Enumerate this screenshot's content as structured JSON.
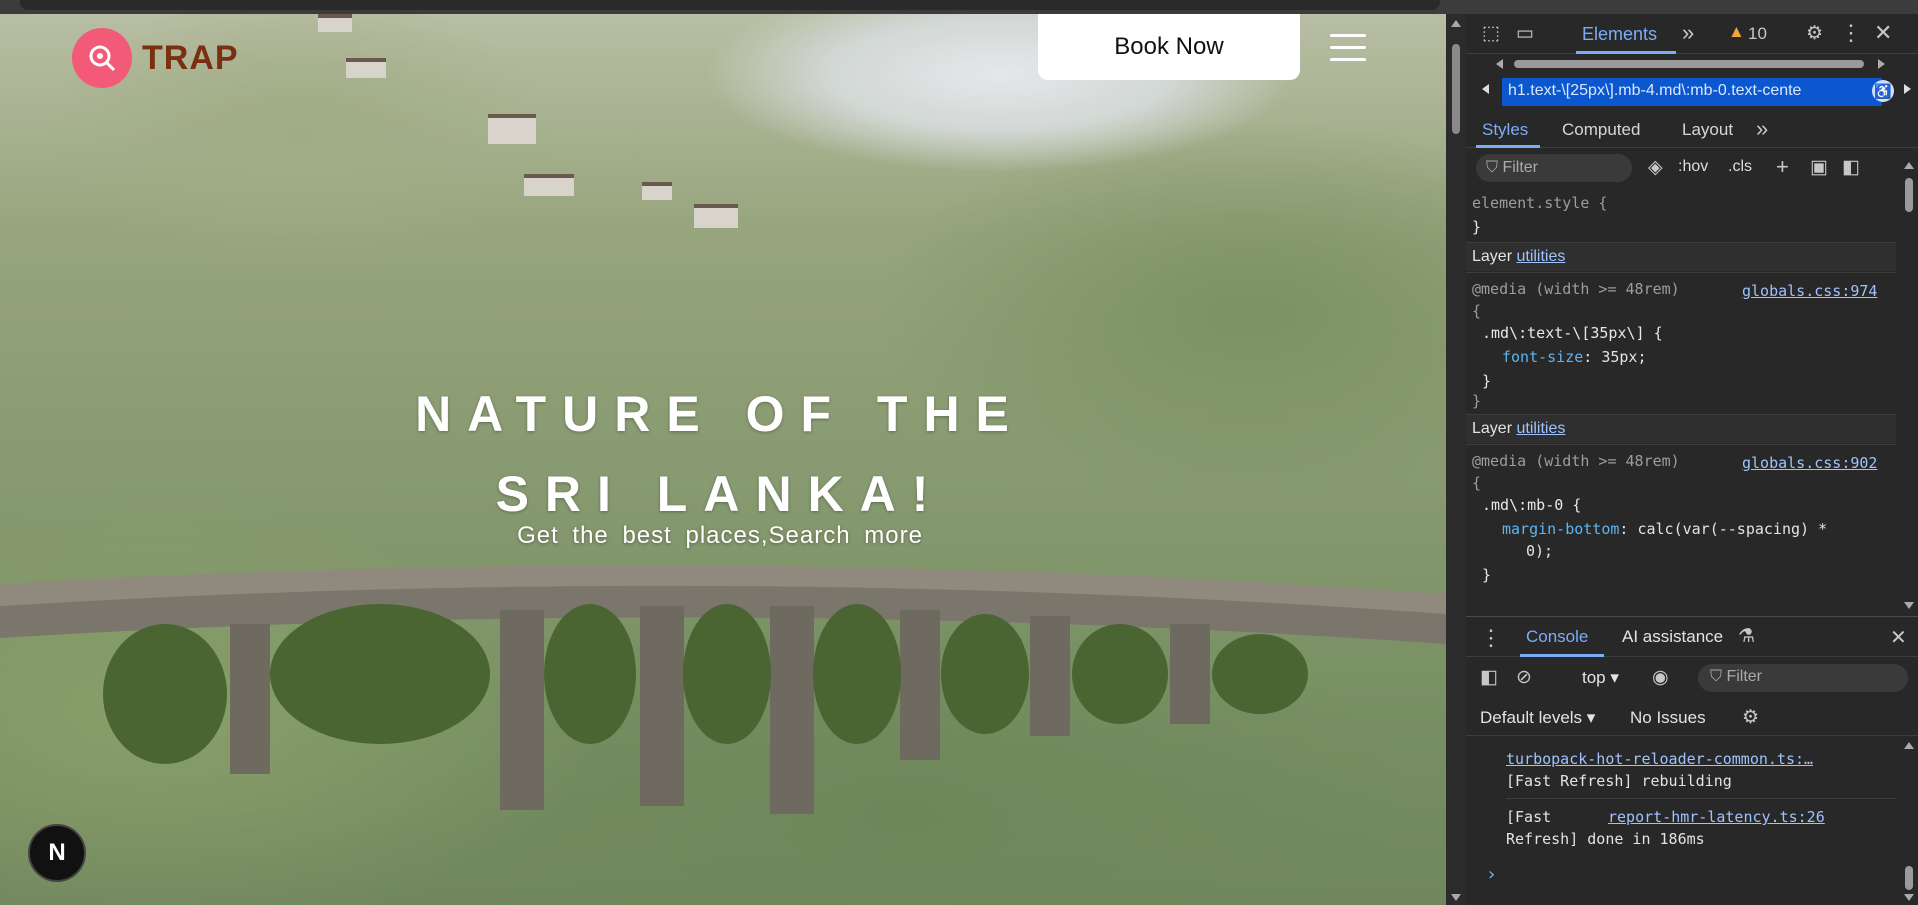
{
  "site": {
    "brand": "TRAP",
    "book_button": "Book Now",
    "hero_title_line1": "NATURE OF THE",
    "hero_title_line2": "SRI LANKA!",
    "hero_subtitle": "Get the best places,Search more",
    "next_badge": "N"
  },
  "devtools": {
    "toolbar": {
      "elements_tab": "Elements",
      "warning_count": "10"
    },
    "breadcrumb": "h1.text-\\[25px\\].mb-4.md\\:mb-0.text-cente",
    "subtabs": {
      "styles": "Styles",
      "computed": "Computed",
      "layout": "Layout"
    },
    "filter_placeholder": "Filter",
    "hov": ":hov",
    "cls": ".cls",
    "rules": {
      "element_style_open": "element.style {",
      "element_style_close": "}",
      "layer1_prefix": "Layer ",
      "layer1_link": "utilities",
      "media1": "@media (width >= 48rem)",
      "source1": "globals.css:974",
      "brace_open1": "{",
      "selector1": ".md\\:text-\\[35px\\] {",
      "prop1_name": "font-size",
      "prop1_value": ": 35px;",
      "close1a": "}",
      "close1b": "}",
      "layer2_prefix": "Layer ",
      "layer2_link": "utilities",
      "media2": "@media (width >= 48rem)",
      "source2": "globals.css:902",
      "brace_open2": "{",
      "selector2": ".md\\:mb-0 {",
      "prop2_name": "margin-bottom",
      "prop2_value": ": calc(var(--spacing) *",
      "prop2_value_cont": "0);",
      "close2": "}"
    },
    "drawer": {
      "console_tab": "Console",
      "ai_tab": "AI assistance",
      "context": "top",
      "filter_placeholder": "Filter",
      "levels": "Default levels",
      "issues": "No Issues",
      "msg1_link": "turbopack-hot-reloader-common.ts:…",
      "msg1_text": "[Fast Refresh] rebuilding",
      "msg2_text_a": "[Fast",
      "msg2_link": "report-hmr-latency.ts:26",
      "msg2_text_b": "Refresh] done in 186ms",
      "prompt": "›"
    }
  }
}
